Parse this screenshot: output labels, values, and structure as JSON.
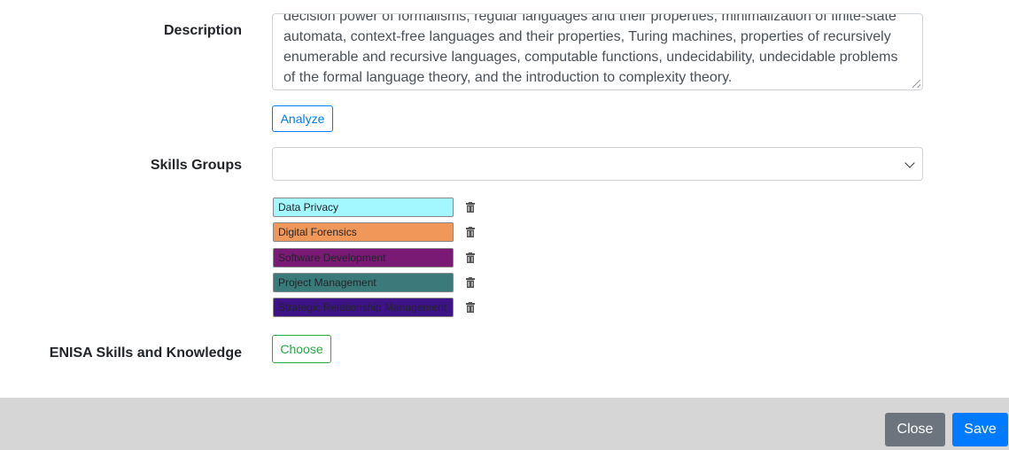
{
  "form": {
    "description_label": "Description",
    "description_text": "decision power of formalisms, regular languages and their properties, minimalization of finite-state\nautomata, context-free languages and their properties, Turing machines, properties of recursively\nenumerable and recursive languages, computable functions, undecidability, undecidable problems\nof the formal language theory, and the introduction to complexity theory.",
    "analyze_label": "Analyze",
    "skills_groups_label": "Skills Groups",
    "skills_groups_selected": "",
    "skill_tags": [
      {
        "label": "Data Privacy",
        "color": "#a3f8ff"
      },
      {
        "label": "Digital Forensics",
        "color": "#f0985a"
      },
      {
        "label": "Software Development",
        "color": "#7a1a75"
      },
      {
        "label": "Project Management",
        "color": "#3a7a7a"
      },
      {
        "label": "Strategic Relationship Management",
        "color": "#3f1388"
      }
    ],
    "enisa_label": "ENISA Skills and Knowledge",
    "choose_label": "Choose"
  },
  "footer": {
    "close_label": "Close",
    "save_label": "Save"
  },
  "icons": {
    "select_caret": "chevron-down-icon",
    "tag_delete": "trash-icon"
  }
}
